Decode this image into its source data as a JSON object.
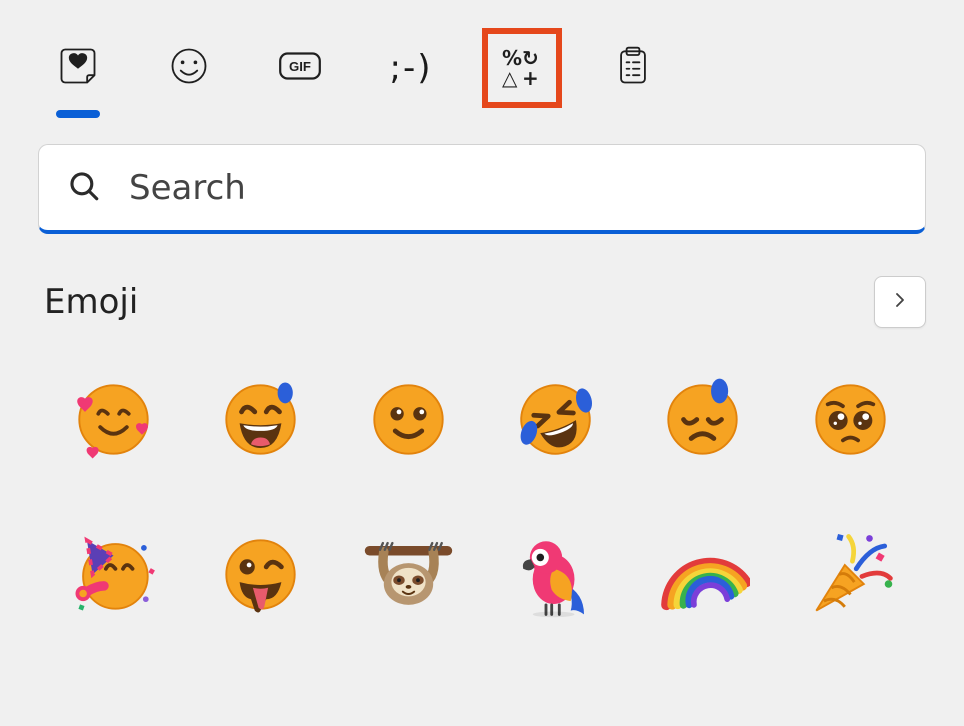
{
  "tabs": {
    "recent": {
      "name": "recent"
    },
    "emoji": {
      "name": "emoji"
    },
    "gif": {
      "name": "gif",
      "label": "GIF"
    },
    "kaomoji": {
      "name": "kaomoji",
      "label": ";-)"
    },
    "symbols": {
      "name": "symbols",
      "glyphs": [
        "%",
        "↻",
        "△",
        "+"
      ]
    },
    "clipboard": {
      "name": "clipboard"
    }
  },
  "search": {
    "placeholder": "Search"
  },
  "section": {
    "title": "Emoji"
  },
  "emojis": [
    {
      "name": "smiling-face-with-hearts"
    },
    {
      "name": "grinning-face-with-sweat"
    },
    {
      "name": "smiling-face"
    },
    {
      "name": "rolling-on-floor-laughing"
    },
    {
      "name": "downcast-face-with-sweat"
    },
    {
      "name": "pleading-face"
    },
    {
      "name": "partying-face"
    },
    {
      "name": "winking-face-with-tongue"
    },
    {
      "name": "sloth"
    },
    {
      "name": "parrot"
    },
    {
      "name": "rainbow"
    },
    {
      "name": "party-popper"
    }
  ],
  "colors": {
    "accent": "#0a5fd6",
    "highlight": "#e5471b",
    "faceYellow": "#f6a322",
    "faceDark": "#e2830c",
    "blue": "#2b5fd9",
    "pink": "#f03974",
    "brown": "#7a4b2b"
  }
}
